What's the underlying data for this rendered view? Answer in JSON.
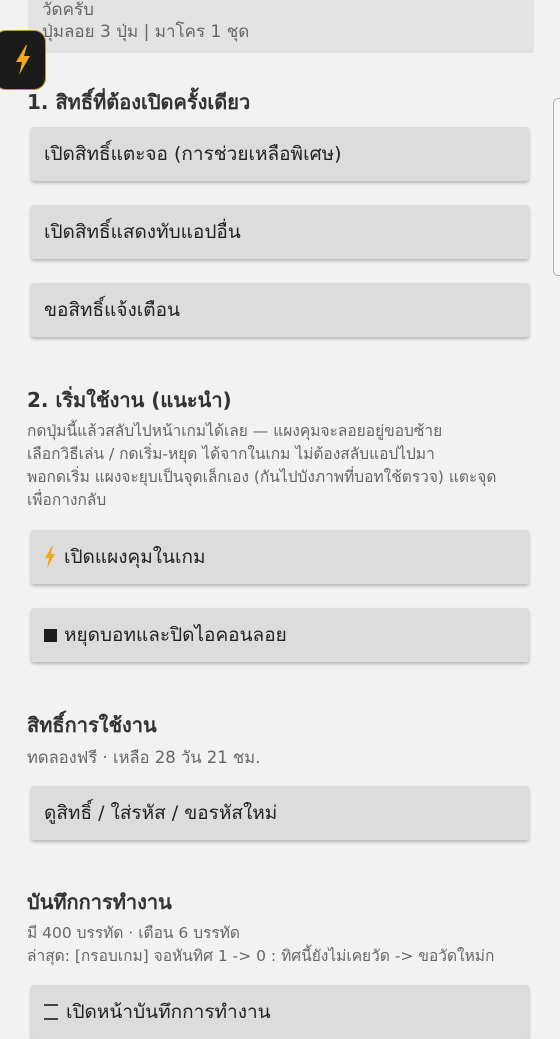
{
  "top_card": {
    "line1": "วัดครับ",
    "line2": "ปุ่มลอย 3 ปุ่ม | มาโคร 1 ชุด"
  },
  "permissions": {
    "title": "1. สิทธิ์ที่ต้องเปิดครั้งเดียว",
    "buttons": [
      "เปิดสิทธิ์แตะจอ (การช่วยเหลือพิเศษ)",
      "เปิดสิทธิ์แสดงทับแอปอื่น",
      "ขอสิทธิ์แจ้งเตือน"
    ]
  },
  "start": {
    "title": "2. เริ่มใช้งาน (แนะนำ)",
    "lines": [
      "กดปุ่มนี้แล้วสลับไปหน้าเกมได้เลย — แผงคุมจะลอยอยู่ขอบซ้าย",
      "เลือกวิธีเล่น / กดเริ่ม-หยุด ได้จากในเกม ไม่ต้องสลับแอปไปมา",
      "พอกดเริ่ม แผงจะยุบเป็นจุดเล็กเอง (กันไปบังภาพที่บอทใช้ตรวจ) แตะจุด",
      "เพื่อกางกลับ"
    ],
    "open_panel_button": "เปิดแผงคุมในเกม",
    "stop_button": "หยุดบอทและปิดไอคอนลอย"
  },
  "license": {
    "title": "สิทธิ์การใช้งาน",
    "status": "ทดลองฟรี · เหลือ 28 วัน 21 ชม.",
    "button": "ดูสิทธิ์ / ใส่รหัส / ขอรหัสใหม่"
  },
  "log": {
    "title": "บันทึกการทำงาน",
    "summary": "มี 400 บรรทัด · เตือน 6 บรรทัด",
    "latest": "ล่าสุด: [กรอบเกม] จอหันทิศ 1 -> 0 : ทิศนี้ยังไม่เคยวัด -> ขอวัดใหม่ก",
    "open_button": "เปิดหน้าบันทึกการทำงาน"
  },
  "colors": {
    "background": "#f2f2f2",
    "button": "#dcdcdc",
    "bolt": "#f0a81c"
  },
  "icons": {
    "float": "lightning-bolt-icon",
    "open_panel": "lightning-bolt-icon",
    "stop": "stop-square-icon",
    "log": "document-icon"
  }
}
